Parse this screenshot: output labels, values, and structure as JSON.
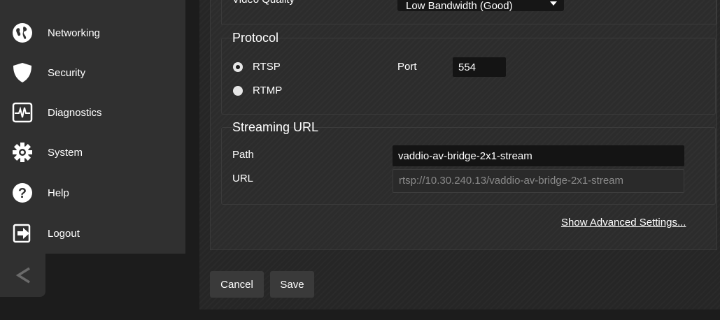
{
  "sidebar": {
    "items": [
      {
        "label": "Networking",
        "icon": "globe-icon"
      },
      {
        "label": "Security",
        "icon": "shield-icon"
      },
      {
        "label": "Diagnostics",
        "icon": "pulse-icon"
      },
      {
        "label": "System",
        "icon": "gear-icon"
      },
      {
        "label": "Help",
        "icon": "question-icon"
      },
      {
        "label": "Logout",
        "icon": "logout-icon"
      }
    ],
    "collapse_icon": "chevron-left-icon"
  },
  "video_quality": {
    "label": "Video Quality",
    "selected": "Low Bandwidth (Good)"
  },
  "protocol": {
    "title": "Protocol",
    "options": [
      {
        "label": "RTSP",
        "checked": true
      },
      {
        "label": "RTMP",
        "checked": false
      }
    ],
    "port_label": "Port",
    "port_value": "554"
  },
  "streaming_url": {
    "title": "Streaming URL",
    "path_label": "Path",
    "path_value": "vaddio-av-bridge-2x1-stream",
    "url_label": "URL",
    "url_value": "rtsp://10.30.240.13/vaddio-av-bridge-2x1-stream"
  },
  "advanced_link": "Show Advanced Settings...",
  "buttons": {
    "cancel": "Cancel",
    "save": "Save"
  },
  "colors": {
    "sidebar_bg": "#303030",
    "panel_bg": "#2c2c2c",
    "input_bg": "#141414"
  }
}
